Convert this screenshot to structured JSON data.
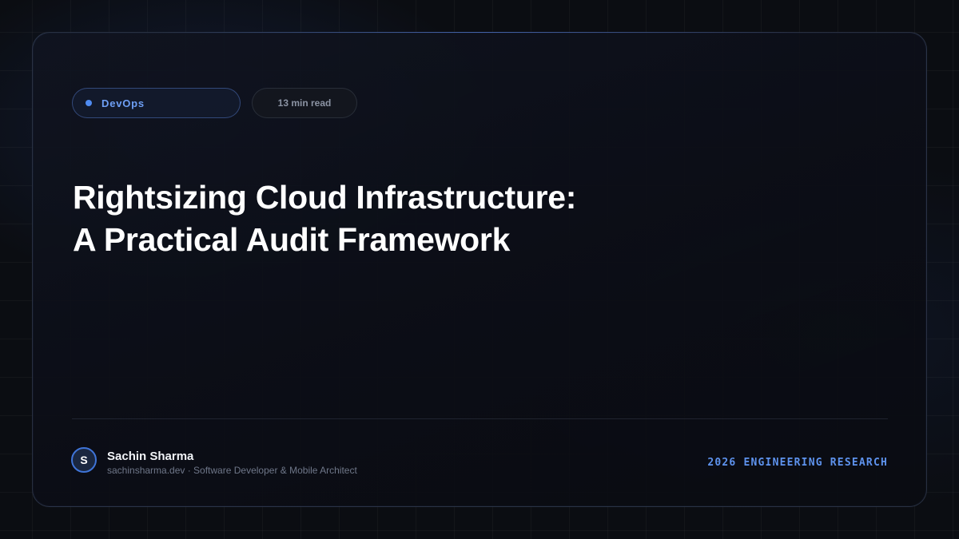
{
  "category": {
    "label": "DevOps",
    "dot_color": "#4f8bf0"
  },
  "reading_time": "13 min read",
  "title": {
    "line1": "Rightsizing Cloud Infrastructure:",
    "line2": "A Practical Audit Framework"
  },
  "author": {
    "initial": "S",
    "name": "Sachin Sharma",
    "subtitle": "sachinsharma.dev · Software Developer & Mobile Architect"
  },
  "footer_label": "2026 ENGINEERING RESEARCH",
  "colors": {
    "background": "#0b0d12",
    "accent": "#5e93ee",
    "title": "#ffffff"
  }
}
